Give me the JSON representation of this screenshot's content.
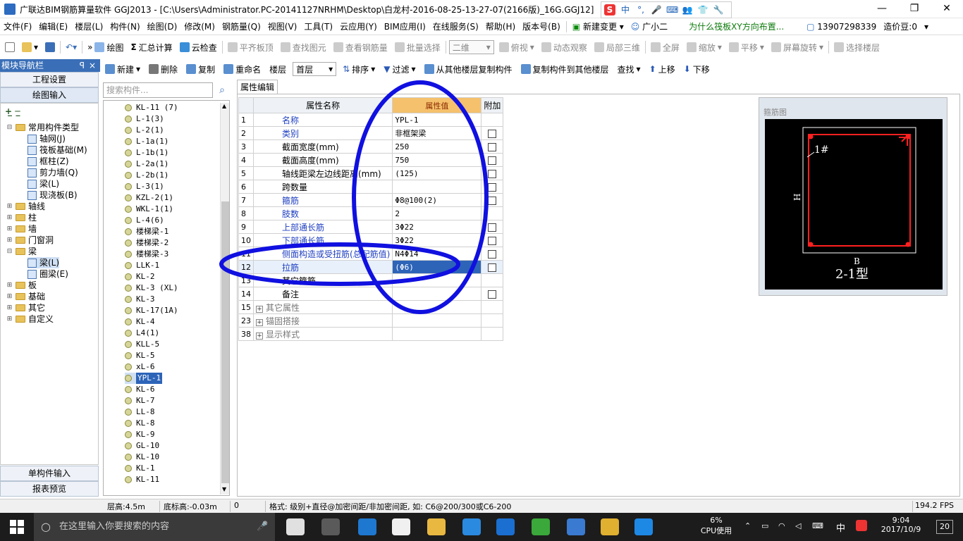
{
  "window": {
    "title": "广联达BIM钢筋算量软件 GGJ2013 - [C:\\Users\\Administrator.PC-20141127NRHM\\Desktop\\白龙村-2016-08-25-13-27-07(2166版)_16G.GGJ12]",
    "ime": [
      "S",
      "中",
      "°,",
      "🎤",
      "⌨",
      "👥",
      "👕",
      "🔧"
    ]
  },
  "menu": {
    "items": [
      "文件(F)",
      "编辑(E)",
      "楼层(L)",
      "构件(N)",
      "绘图(D)",
      "修改(M)",
      "钢筋量(Q)",
      "视图(V)",
      "工具(T)",
      "云应用(Y)",
      "BIM应用(I)",
      "在线服务(S)",
      "帮助(H)",
      "版本号(B)"
    ],
    "new_change": "新建变更",
    "assistant": "广小二",
    "question": "为什么筏板XY方向布置...",
    "phone": "13907298339",
    "coins": "造价豆:0"
  },
  "toolbar1": {
    "draw": "绘图",
    "sum": "汇总计算",
    "cloud_check": "云检查",
    "align_top": "平齐板顶",
    "find_elem": "查找图元",
    "view_rebar": "查看钢筋量",
    "batch_select": "批量选择",
    "view_mode": "二维",
    "top_view": "俯视",
    "dynamic": "动态观察",
    "local_3d": "局部三维",
    "fullscreen": "全屏",
    "zoom": "缩放",
    "pan": "平移",
    "rotate": "屏幕旋转",
    "select_floor": "选择楼层"
  },
  "nav": {
    "header": "模块导航栏",
    "pin": "ꟼ",
    "close": "×",
    "project_settings": "工程设置",
    "drawing_input": "绘图输入",
    "single_input": "单构件输入",
    "report_preview": "报表预览",
    "tree": [
      {
        "label": "常用构件类型",
        "level": 0,
        "toggle": "⊟",
        "folder": true
      },
      {
        "label": "轴网(J)",
        "level": 1
      },
      {
        "label": "筏板基础(M)",
        "level": 1
      },
      {
        "label": "框柱(Z)",
        "level": 1
      },
      {
        "label": "剪力墙(Q)",
        "level": 1
      },
      {
        "label": "梁(L)",
        "level": 1
      },
      {
        "label": "现浇板(B)",
        "level": 1
      },
      {
        "label": "轴线",
        "level": 0,
        "toggle": "⊞",
        "folder": true
      },
      {
        "label": "柱",
        "level": 0,
        "toggle": "⊞",
        "folder": true
      },
      {
        "label": "墙",
        "level": 0,
        "toggle": "⊞",
        "folder": true
      },
      {
        "label": "门窗洞",
        "level": 0,
        "toggle": "⊞",
        "folder": true
      },
      {
        "label": "梁",
        "level": 0,
        "toggle": "⊟",
        "folder": true
      },
      {
        "label": "梁(L)",
        "level": 1,
        "selected": true
      },
      {
        "label": "圈梁(E)",
        "level": 1
      },
      {
        "label": "板",
        "level": 0,
        "toggle": "⊞",
        "folder": true
      },
      {
        "label": "基础",
        "level": 0,
        "toggle": "⊞",
        "folder": true
      },
      {
        "label": "其它",
        "level": 0,
        "toggle": "⊞",
        "folder": true
      },
      {
        "label": "自定义",
        "level": 0,
        "toggle": "⊞",
        "folder": true
      }
    ]
  },
  "toolbar2": {
    "new": "新建",
    "delete": "删除",
    "copy": "复制",
    "rename": "重命名",
    "floor_label": "楼层",
    "floor_value": "首层",
    "sort": "排序",
    "filter": "过滤",
    "copy_from_floor": "从其他楼层复制构件",
    "copy_to_floor": "复制构件到其他楼层",
    "find": "查找",
    "move_up": "上移",
    "move_down": "下移"
  },
  "search": {
    "placeholder": "搜索构件..."
  },
  "components": [
    "KL-11 (7)",
    "L-1(3)",
    "L-2(1)",
    "L-1a(1)",
    "L-1b(1)",
    "L-2a(1)",
    "L-2b(1)",
    "L-3(1)",
    "KZL-2(1)",
    "WKL-1(1)",
    "L-4(6)",
    "楼梯梁-1",
    "楼梯梁-2",
    "楼梯梁-3",
    "LLK-1",
    "KL-2",
    "KL-3 (XL)",
    "KL-3",
    "KL-17(1A)",
    "KL-4",
    "L4(1)",
    "KLL-5",
    "KL-5",
    "xL-6",
    "YPL-1",
    "KL-6",
    "KL-7",
    "LL-8",
    "KL-8",
    "KL-9",
    "GL-10",
    "KL-10",
    "KL-1",
    "KL-11"
  ],
  "selected_component": "YPL-1",
  "properties": {
    "tab": "属性编辑",
    "headers": {
      "name": "属性名称",
      "value": "属性值",
      "extra": "附加"
    },
    "rows": [
      {
        "no": "1",
        "name": "名称",
        "value": "YPL-1",
        "blue": true,
        "check": false
      },
      {
        "no": "2",
        "name": "类别",
        "value": "非框架梁",
        "blue": true,
        "check": true
      },
      {
        "no": "3",
        "name": "截面宽度(mm)",
        "value": "250",
        "blue": false,
        "check": true
      },
      {
        "no": "4",
        "name": "截面高度(mm)",
        "value": "750",
        "blue": false,
        "check": true
      },
      {
        "no": "5",
        "name": "轴线距梁左边线距离(mm)",
        "value": "(125)",
        "blue": false,
        "check": true
      },
      {
        "no": "6",
        "name": "跨数量",
        "value": "",
        "blue": false,
        "check": true
      },
      {
        "no": "7",
        "name": "箍筋",
        "value": "Φ8@100(2)",
        "blue": true,
        "check": true
      },
      {
        "no": "8",
        "name": "肢数",
        "value": "2",
        "blue": true,
        "check": false
      },
      {
        "no": "9",
        "name": "上部通长筋",
        "value": "3Φ22",
        "blue": true,
        "check": true
      },
      {
        "no": "10",
        "name": "下部通长筋",
        "value": "3Φ22",
        "blue": true,
        "check": true
      },
      {
        "no": "11",
        "name": "侧面构造或受扭筋(总配筋值)",
        "value": "N4Φ14",
        "blue": true,
        "check": true
      },
      {
        "no": "12",
        "name": "拉筋",
        "value": "(Φ6)",
        "blue": true,
        "check": true,
        "highlight": true
      },
      {
        "no": "13",
        "name": "其它箍筋",
        "value": "",
        "blue": false,
        "check": false
      },
      {
        "no": "14",
        "name": "备注",
        "value": "",
        "blue": false,
        "check": true
      },
      {
        "no": "15",
        "name": "其它属性",
        "value": "",
        "group": true
      },
      {
        "no": "23",
        "name": "锚固搭接",
        "value": "",
        "group": true
      },
      {
        "no": "38",
        "name": "显示样式",
        "value": "",
        "group": true
      }
    ]
  },
  "stirrup": {
    "title": "箍筋图",
    "label_1": "1#",
    "label_h": "H",
    "label_b": "B",
    "type": "2-1型",
    "bar_color": "#ff2020"
  },
  "annotation_color": "#1010e0",
  "status": {
    "floor_height": "层高:4.5m",
    "base_height": "底标高:-0.03m",
    "zero": "0",
    "hint": "格式: 级别+直径@加密间距/非加密间距, 如: C6@200/300或C6-200",
    "fps": "194.2 FPS"
  },
  "taskbar": {
    "search_placeholder": "在这里输入你要搜索的内容",
    "cpu": "6%",
    "cpu_label": "CPU使用",
    "ime": "中",
    "time": "9:04",
    "date": "2017/10/9",
    "notif": "20"
  }
}
